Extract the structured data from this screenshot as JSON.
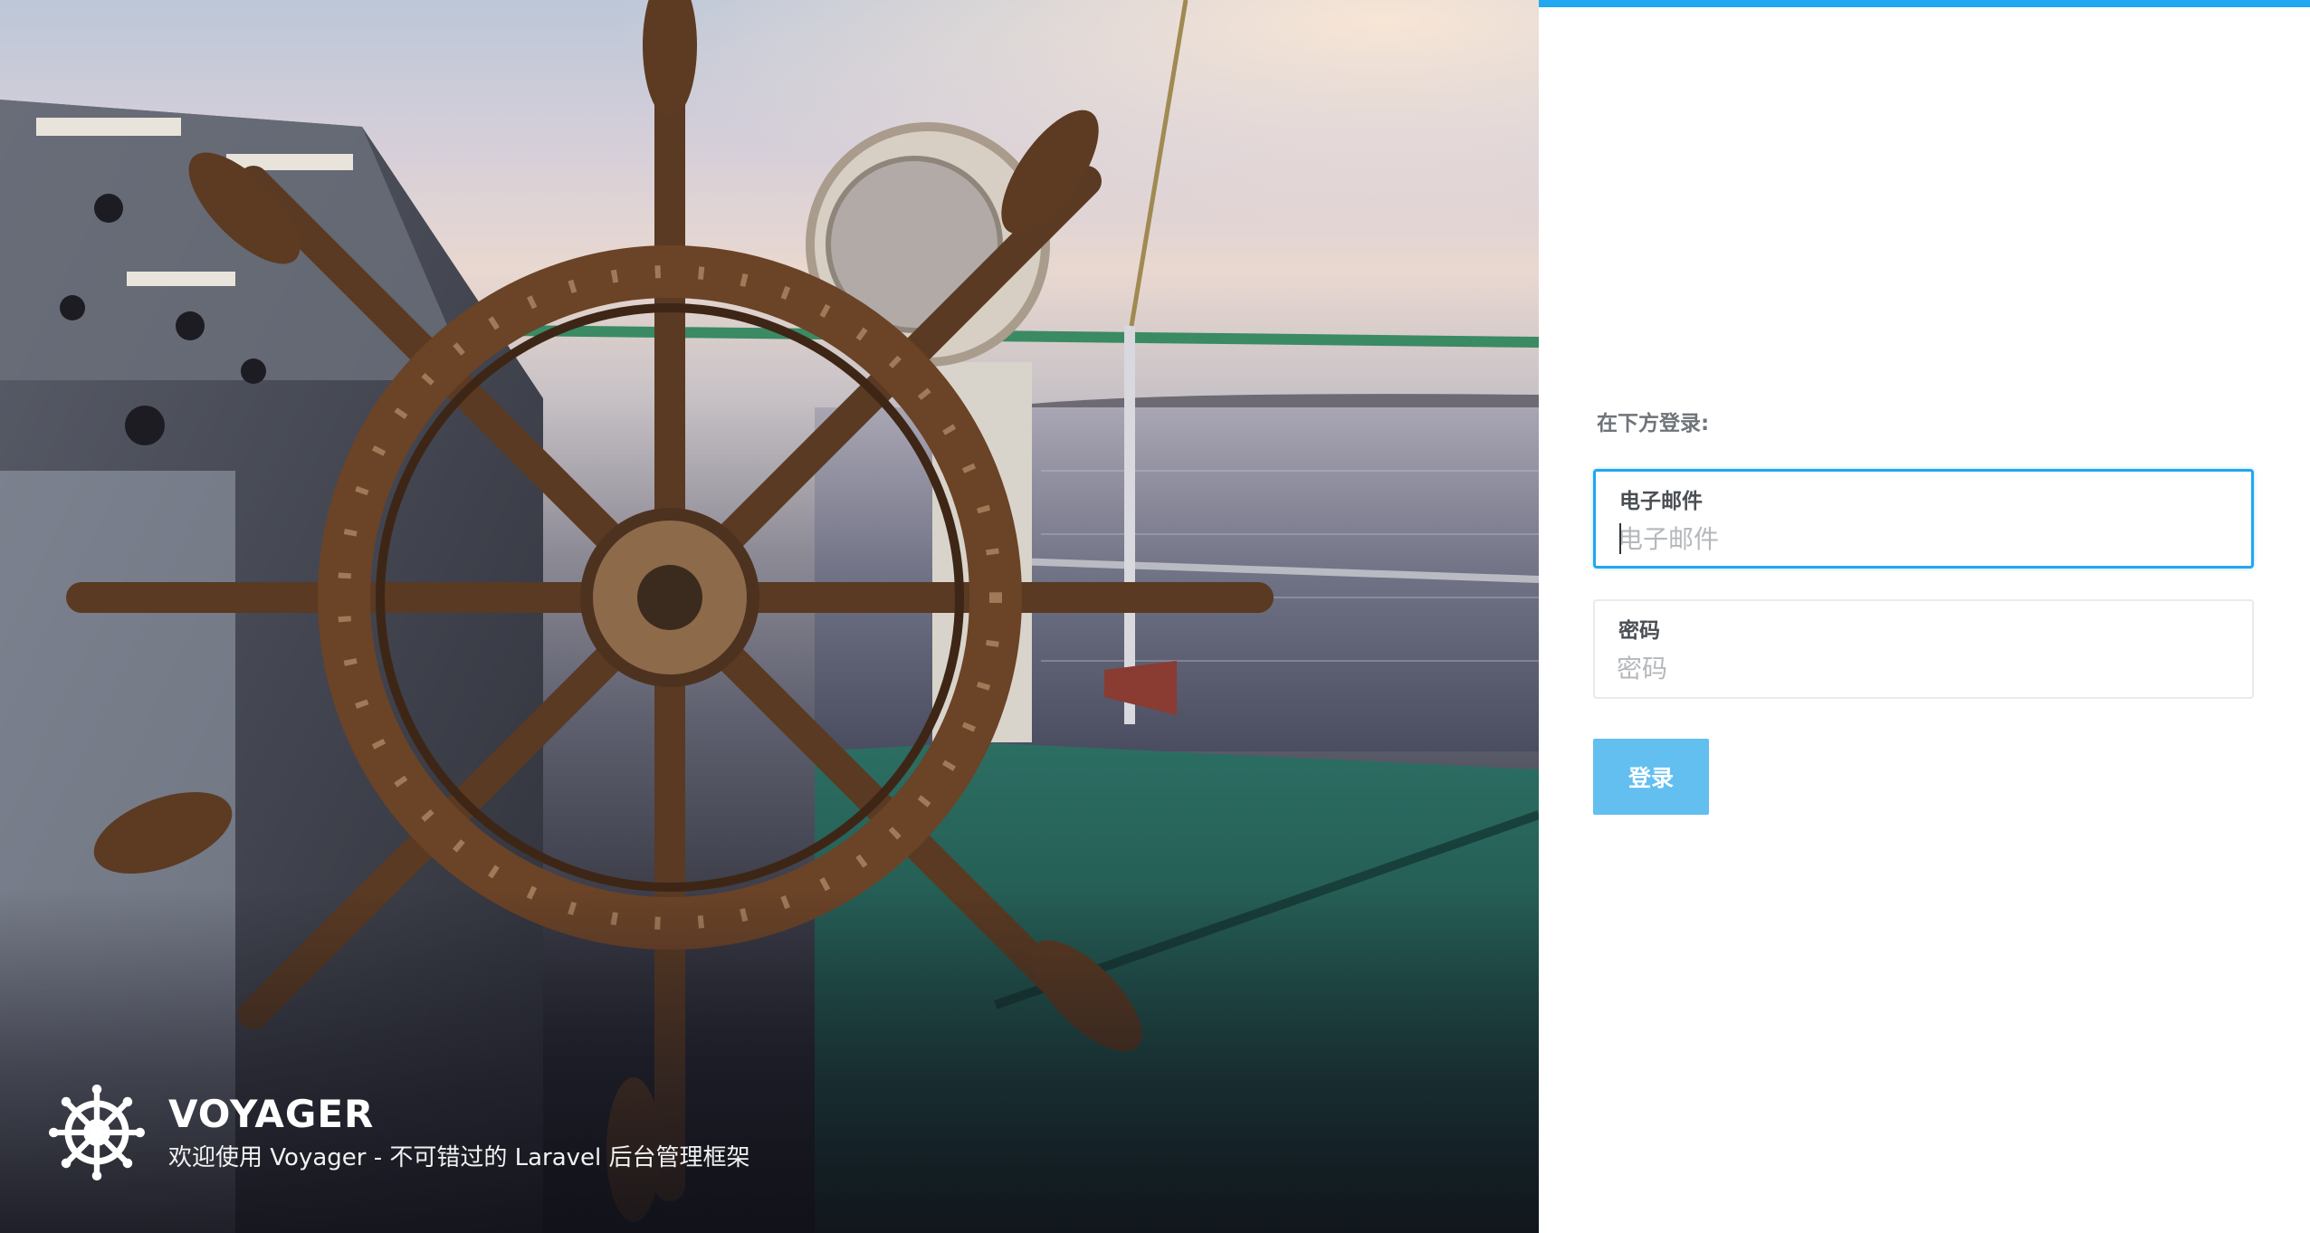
{
  "brand": {
    "title": "VOYAGER",
    "subtitle": "欢迎使用 Voyager - 不可错过的 Laravel 后台管理框架",
    "logo_icon": "ship-wheel-icon"
  },
  "hero": {
    "image_icon": "ship-helm-photo"
  },
  "login": {
    "heading": "在下方登录:",
    "email": {
      "label": "电子邮件",
      "placeholder": "电子邮件",
      "value": ""
    },
    "password": {
      "label": "密码",
      "placeholder": "密码",
      "value": ""
    },
    "submit_label": "登录"
  },
  "colors": {
    "accent": "#22a7f0",
    "button": "#62bff0",
    "heading_text": "#6f7479"
  }
}
